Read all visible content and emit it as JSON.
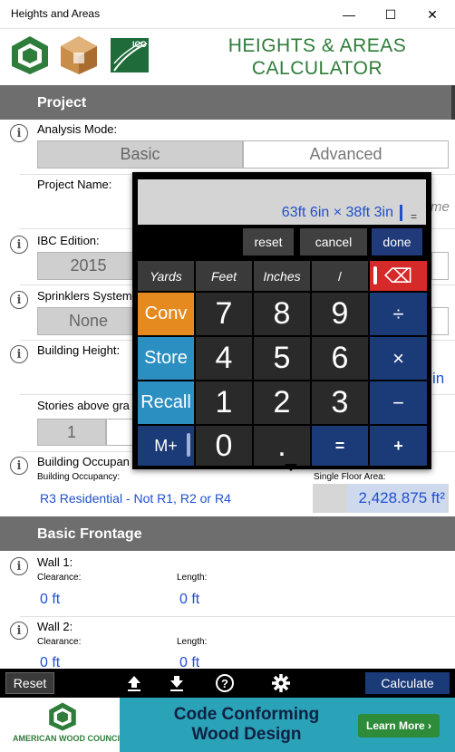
{
  "window": {
    "title": "Heights and Areas",
    "min": "—",
    "max": "☐",
    "close": "✕"
  },
  "header": {
    "title_line1": "HEIGHTS & AREAS",
    "title_line2": "CALCULATOR",
    "icc_logo": "ICC"
  },
  "project": {
    "section_title": "Project",
    "analysis_mode_label": "Analysis Mode:",
    "mode_basic": "Basic",
    "mode_advanced": "Advanced",
    "project_name_label": "Project Name:",
    "project_name_placeholder_fragment": "me",
    "ibc_edition_label": "IBC Edition:",
    "ibc_edition_value": "2015",
    "sprinklers_label": "Sprinklers System",
    "sprinklers_value": "None",
    "building_height_label": "Building Height:",
    "building_height_unit_fragment": "in",
    "stories_label": "Stories above gra",
    "stories_value": "1",
    "occupancy_title": "Building Occupan",
    "occupancy_label": "Building Occupancy:",
    "occupancy_value": "R3 Residential - Not R1, R2 or R4",
    "floor_area_label": "Single Floor Area:",
    "floor_area_value": "2,428.875 ft²"
  },
  "frontage": {
    "section_title": "Basic Frontage",
    "walls": [
      {
        "title": "Wall 1:",
        "clearance_label": "Clearance:",
        "clearance_value": "0 ft",
        "length_label": "Length:",
        "length_value": "0 ft"
      },
      {
        "title": "Wall 2:",
        "clearance_label": "Clearance:",
        "clearance_value": "0 ft",
        "length_label": "Length:",
        "length_value": "0 ft"
      }
    ]
  },
  "calculator": {
    "expression": "63ft 6in × 38ft 3in",
    "equals": "=",
    "reset": "reset",
    "cancel": "cancel",
    "done": "done",
    "units": [
      "Yards",
      "Feet",
      "Inches",
      "/"
    ],
    "backspace": "⌫",
    "conv": "Conv",
    "store": "Store",
    "recall": "Recall",
    "mplus": "M+",
    "digits": [
      "7",
      "8",
      "9",
      "4",
      "5",
      "6",
      "1",
      "2",
      "3",
      "0",
      "."
    ],
    "ops": {
      "divide": "÷",
      "multiply": "×",
      "minus": "−",
      "equals": "=",
      "plus": "+"
    }
  },
  "toolbar": {
    "reset": "Reset",
    "calculate": "Calculate"
  },
  "ad": {
    "line1": "Code Conforming",
    "line2": "Wood Design",
    "button": "Learn More ›",
    "council": "AMERICAN WOOD COUNCIL"
  },
  "colors": {
    "brand_green": "#2e7d3a",
    "value_blue": "#1f4fd1",
    "calc_orange": "#e58a1f",
    "calc_blue": "#2b8fc2",
    "calc_navy": "#1b3a78",
    "calc_red": "#d62929"
  }
}
